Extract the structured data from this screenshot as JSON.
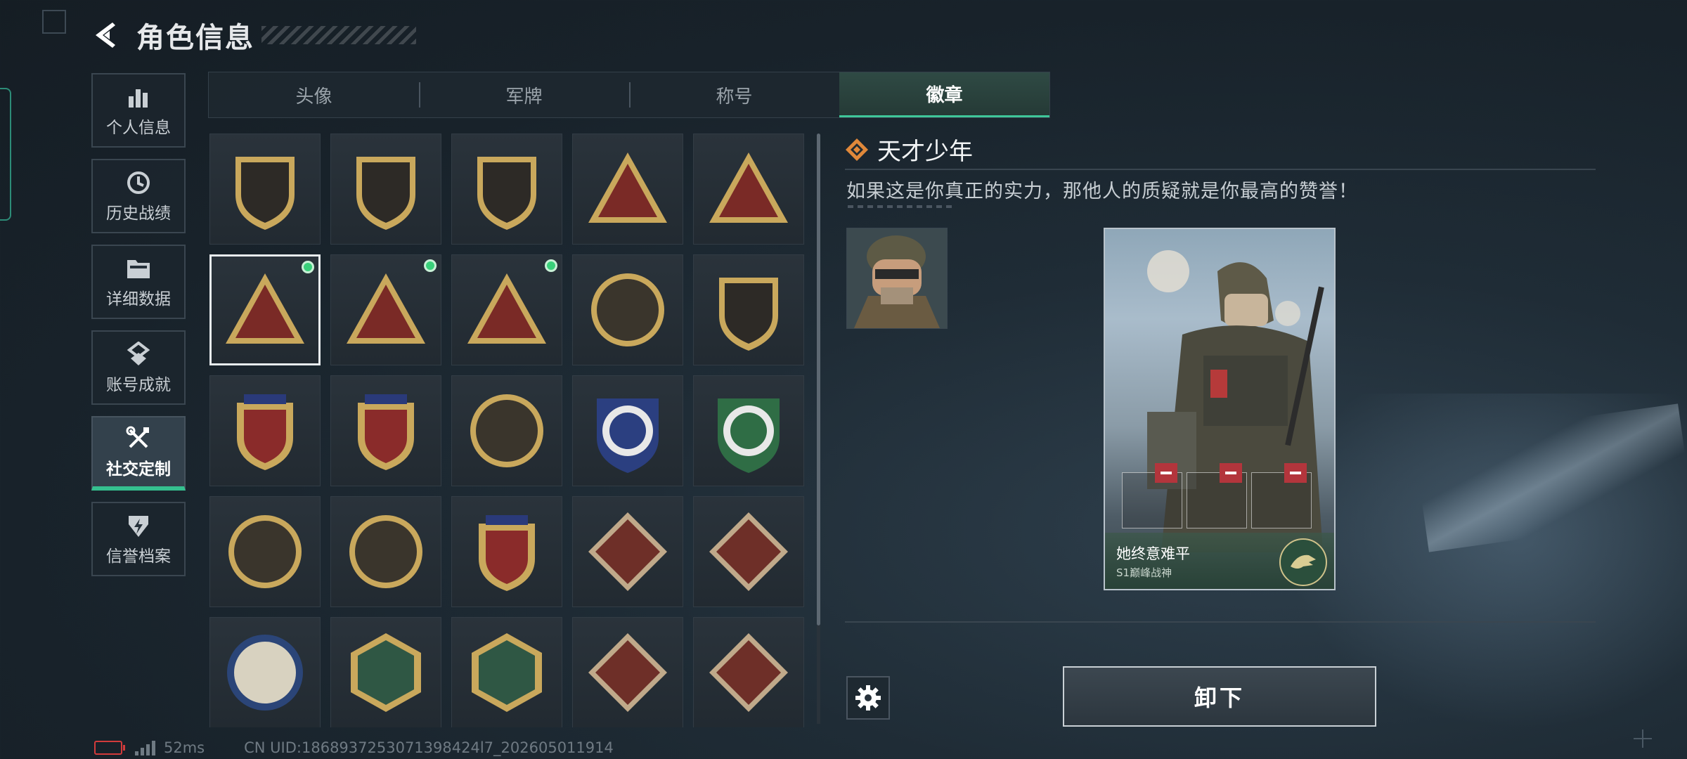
{
  "page": {
    "title": "角色信息"
  },
  "sidebar": {
    "items": [
      {
        "label": "个人信息",
        "icon": "bar-chart-icon",
        "active": false
      },
      {
        "label": "历史战绩",
        "icon": "history-icon",
        "active": false
      },
      {
        "label": "详细数据",
        "icon": "folder-icon",
        "active": false
      },
      {
        "label": "账号成就",
        "icon": "achievement-icon",
        "active": false
      },
      {
        "label": "社交定制",
        "icon": "tools-icon",
        "active": true
      },
      {
        "label": "信誉档案",
        "icon": "lightning-shield-icon",
        "active": false
      }
    ]
  },
  "tabs": [
    {
      "label": "头像",
      "active": false
    },
    {
      "label": "军牌",
      "active": false
    },
    {
      "label": "称号",
      "active": false
    },
    {
      "label": "徽章",
      "active": true
    }
  ],
  "badges": [
    {
      "name": "shield-triangle-badge",
      "selected": false,
      "equipped": false
    },
    {
      "name": "helicopter-badge",
      "selected": false,
      "equipped": false
    },
    {
      "name": "dagger-shield-badge",
      "selected": false,
      "equipped": false
    },
    {
      "name": "fist-triangle-badge",
      "selected": false,
      "equipped": false
    },
    {
      "name": "number-one-triangle-badge",
      "selected": false,
      "equipped": false
    },
    {
      "name": "usb-triangle-badge",
      "selected": true,
      "equipped": true
    },
    {
      "name": "soldiers-triangle-badge",
      "selected": false,
      "equipped": true
    },
    {
      "name": "rocket-triangle-badge",
      "selected": false,
      "equipped": true
    },
    {
      "name": "star-skull-badge",
      "selected": false,
      "equipped": false
    },
    {
      "name": "chevron-shield-badge",
      "selected": false,
      "equipped": false
    },
    {
      "name": "crest-emblem-badge",
      "selected": false,
      "equipped": false
    },
    {
      "name": "diamond-crest-badge",
      "selected": false,
      "equipped": false
    },
    {
      "name": "skull-circle-badge",
      "selected": false,
      "equipped": false
    },
    {
      "name": "blue-rifle-shield-badge",
      "selected": false,
      "equipped": false
    },
    {
      "name": "green-rifle-shield-badge",
      "selected": false,
      "equipped": false
    },
    {
      "name": "rifle-shield-badge",
      "selected": false,
      "equipped": false
    },
    {
      "name": "sniper-shield-badge",
      "selected": false,
      "equipped": false
    },
    {
      "name": "golden-rifle-crest-badge",
      "selected": false,
      "equipped": false
    },
    {
      "name": "wolf-diamond-badge",
      "selected": false,
      "equipped": false
    },
    {
      "name": "wolf-diamond-badge-2",
      "selected": false,
      "equipped": false
    },
    {
      "name": "eagle-circle-badge",
      "selected": false,
      "equipped": false
    },
    {
      "name": "wasp-hexagon-badge",
      "selected": false,
      "equipped": false
    },
    {
      "name": "medic-hexagon-badge",
      "selected": false,
      "equipped": false
    },
    {
      "name": "dragon-diamond-badge",
      "selected": false,
      "equipped": false
    },
    {
      "name": "runner-diamond-badge",
      "selected": false,
      "equipped": false
    }
  ],
  "detail": {
    "title": "天才少年",
    "description": "如果这是你真正的实力，那他人的质疑就是你最高的赞誉！"
  },
  "card": {
    "name": "她终意难平",
    "subtitle": "S1巅峰战神"
  },
  "buttons": {
    "unload": "卸下"
  },
  "status": {
    "ping": "52ms",
    "uid": "CN UID:1868937253071398424l7_202605011914"
  },
  "colors": {
    "accent_green": "#35c08f",
    "badge_gold": "#c9a85c",
    "badge_red": "#7a2a26",
    "equipped_dot": "#39d07a",
    "remove_red": "#b3353c"
  }
}
